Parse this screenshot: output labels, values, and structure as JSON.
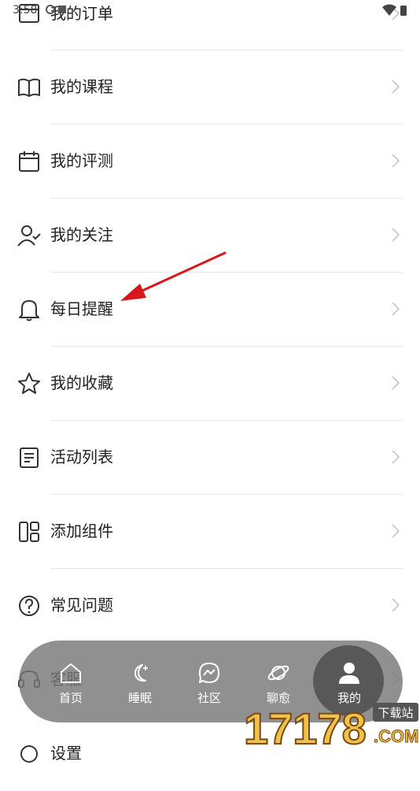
{
  "status_bar": {
    "time": "3:58"
  },
  "menu": {
    "items": [
      {
        "label": "我的订单",
        "icon": "order-icon"
      },
      {
        "label": "我的课程",
        "icon": "book-icon"
      },
      {
        "label": "我的评测",
        "icon": "calendar-icon"
      },
      {
        "label": "我的关注",
        "icon": "user-check-icon"
      },
      {
        "label": "每日提醒",
        "icon": "bell-icon"
      },
      {
        "label": "我的收藏",
        "icon": "star-icon"
      },
      {
        "label": "活动列表",
        "icon": "document-icon"
      },
      {
        "label": "添加组件",
        "icon": "widget-icon"
      },
      {
        "label": "常见问题",
        "icon": "help-icon"
      },
      {
        "label": "客服",
        "icon": "headset-icon"
      },
      {
        "label": "设置",
        "icon": "settings-icon"
      }
    ]
  },
  "tabbar": {
    "tabs": [
      {
        "label": "首页",
        "icon": "home-icon"
      },
      {
        "label": "睡眠",
        "icon": "moon-icon"
      },
      {
        "label": "社区",
        "icon": "chat-icon"
      },
      {
        "label": "聊愈",
        "icon": "planet-icon"
      },
      {
        "label": "我的",
        "icon": "profile-icon"
      }
    ],
    "active_index": 4
  },
  "watermark": {
    "number": "17178",
    "tag": "下载站",
    "suffix": ".COM"
  },
  "colors": {
    "annotation_arrow": "#d9171a",
    "tabbar_bg": "#787878",
    "tab_active": "#585858"
  }
}
